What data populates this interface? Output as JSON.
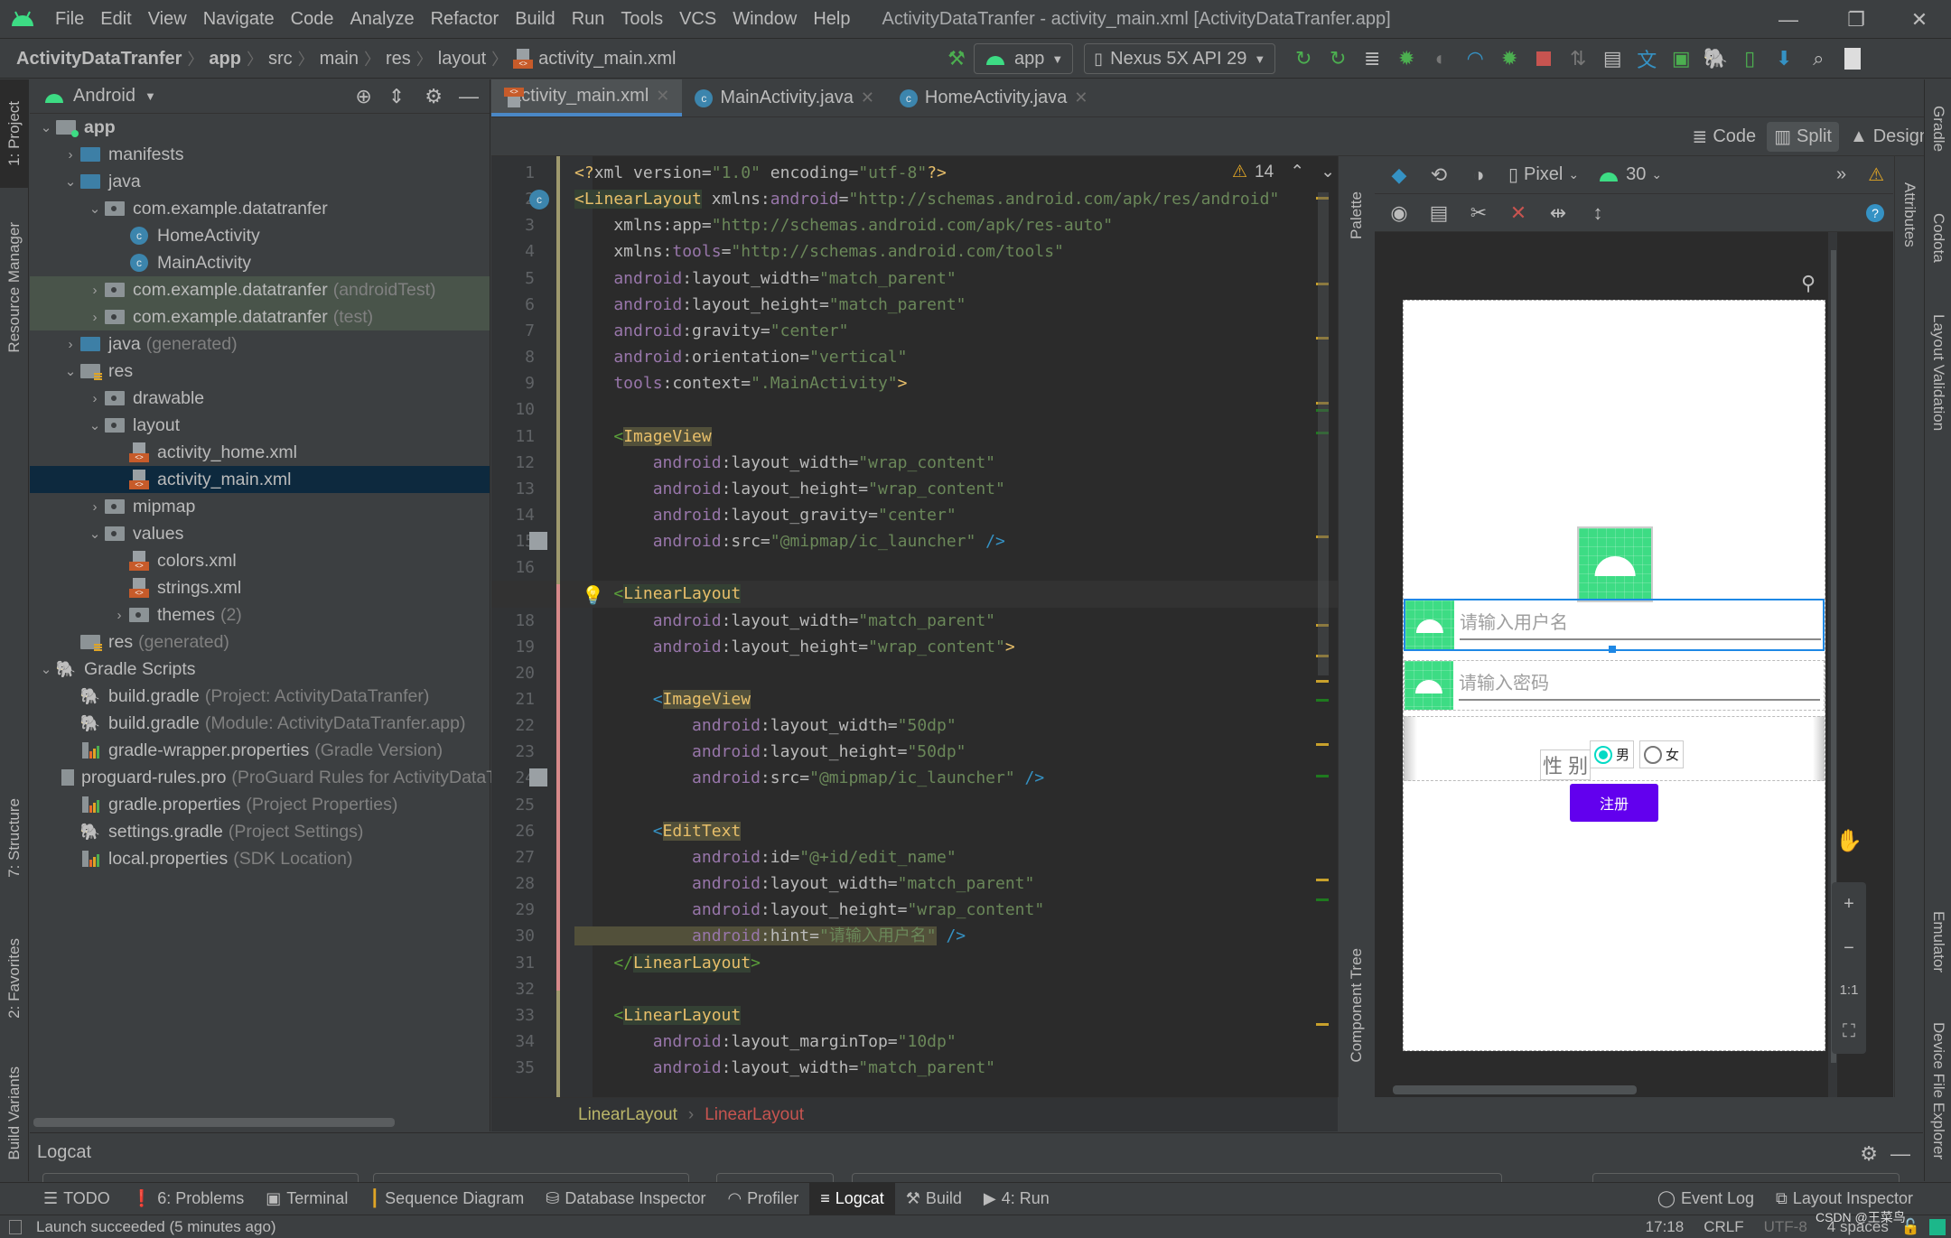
{
  "window": {
    "title": "ActivityDataTranfer - activity_main.xml [ActivityDataTranfer.app]",
    "menu": [
      "File",
      "Edit",
      "View",
      "Navigate",
      "Code",
      "Analyze",
      "Refactor",
      "Build",
      "Run",
      "Tools",
      "VCS",
      "Window",
      "Help"
    ],
    "controls": {
      "minimize": "—",
      "restore": "❐",
      "close": "✕"
    }
  },
  "navbar": {
    "breadcrumb": [
      "ActivityDataTranfer",
      "app",
      "src",
      "main",
      "res",
      "layout",
      "activity_main.xml"
    ],
    "run_config": "app",
    "device": "Nexus 5X API 29"
  },
  "left_stripe": {
    "project": "1: Project",
    "resource_manager": "Resource Manager",
    "structure": "7: Structure",
    "favorites": "2: Favorites",
    "build_variants": "Build Variants"
  },
  "project_panel": {
    "view": "Android",
    "tree": [
      {
        "label": "app",
        "depth": 0,
        "expanded": true,
        "icon": "module-folder-icon",
        "bold": true
      },
      {
        "label": "manifests",
        "depth": 1,
        "expanded": false,
        "icon": "folder-icon",
        "color": "blue"
      },
      {
        "label": "java",
        "depth": 1,
        "expanded": true,
        "icon": "folder-icon",
        "color": "blue"
      },
      {
        "label": "com.example.datatranfer",
        "depth": 2,
        "expanded": true,
        "icon": "package-icon"
      },
      {
        "label": "HomeActivity",
        "depth": 3,
        "icon": "class-icon"
      },
      {
        "label": "MainActivity",
        "depth": 3,
        "icon": "class-icon"
      },
      {
        "label": "com.example.datatranfer",
        "suffix": "(androidTest)",
        "depth": 2,
        "expanded": false,
        "icon": "package-icon",
        "test": true
      },
      {
        "label": "com.example.datatranfer",
        "suffix": "(test)",
        "depth": 2,
        "expanded": false,
        "icon": "package-icon",
        "test": true
      },
      {
        "label": "java",
        "suffix": "(generated)",
        "depth": 1,
        "expanded": false,
        "icon": "generated-folder-icon"
      },
      {
        "label": "res",
        "depth": 1,
        "expanded": true,
        "icon": "res-folder-icon"
      },
      {
        "label": "drawable",
        "depth": 2,
        "expanded": false,
        "icon": "package-icon"
      },
      {
        "label": "layout",
        "depth": 2,
        "expanded": true,
        "icon": "package-icon"
      },
      {
        "label": "activity_home.xml",
        "depth": 3,
        "icon": "xml-file-icon"
      },
      {
        "label": "activity_main.xml",
        "depth": 3,
        "icon": "xml-file-icon",
        "selected": true
      },
      {
        "label": "mipmap",
        "depth": 2,
        "expanded": false,
        "icon": "package-icon"
      },
      {
        "label": "values",
        "depth": 2,
        "expanded": true,
        "icon": "package-icon"
      },
      {
        "label": "colors.xml",
        "depth": 3,
        "icon": "xml-file-icon"
      },
      {
        "label": "strings.xml",
        "depth": 3,
        "icon": "xml-file-icon"
      },
      {
        "label": "themes",
        "suffix": "(2)",
        "depth": 3,
        "expanded": false,
        "icon": "package-icon"
      },
      {
        "label": "res",
        "suffix": "(generated)",
        "depth": 1,
        "icon": "res-folder-icon"
      },
      {
        "label": "Gradle Scripts",
        "depth": 0,
        "expanded": true,
        "icon": "gradle-icon"
      },
      {
        "label": "build.gradle",
        "suffix": "(Project: ActivityDataTranfer)",
        "depth": 1,
        "icon": "gradle-icon"
      },
      {
        "label": "build.gradle",
        "suffix": "(Module: ActivityDataTranfer.app)",
        "depth": 1,
        "icon": "gradle-icon"
      },
      {
        "label": "gradle-wrapper.properties",
        "suffix": "(Gradle Version)",
        "depth": 1,
        "icon": "properties-icon"
      },
      {
        "label": "proguard-rules.pro",
        "suffix": "(ProGuard Rules for ActivityDataTranfer.app)",
        "depth": 1,
        "icon": "text-file-icon"
      },
      {
        "label": "gradle.properties",
        "suffix": "(Project Properties)",
        "depth": 1,
        "icon": "properties-icon"
      },
      {
        "label": "settings.gradle",
        "suffix": "(Project Settings)",
        "depth": 1,
        "icon": "gradle-icon"
      },
      {
        "label": "local.properties",
        "suffix": "(SDK Location)",
        "depth": 1,
        "icon": "properties-icon"
      }
    ]
  },
  "editor_tabs": [
    {
      "label": "activity_main.xml",
      "icon": "xml-file-icon",
      "active": true
    },
    {
      "label": "MainActivity.java",
      "icon": "class-icon"
    },
    {
      "label": "HomeActivity.java",
      "icon": "class-icon"
    }
  ],
  "view_modes": {
    "code": "Code",
    "split": "Split",
    "design": "Design",
    "active": "split"
  },
  "warnings": {
    "count": "14"
  },
  "code_lines": [
    [
      [
        "pi",
        "<?"
      ],
      [
        "attr",
        "xml version"
      ],
      [
        "pl",
        "="
      ],
      [
        "str",
        "\"1.0\""
      ],
      [
        "attr",
        " encoding"
      ],
      [
        "pl",
        "="
      ],
      [
        "str",
        "\"utf-8\""
      ],
      [
        "pi",
        "?>"
      ]
    ],
    [
      [
        "tagh",
        "<LinearLayout"
      ],
      [
        "attr",
        " xmlns:"
      ],
      [
        "ns",
        "android"
      ],
      [
        "pl",
        "="
      ],
      [
        "str",
        "\"http://schemas.android.com/apk/res/android\""
      ]
    ],
    [
      [
        "attr",
        "    xmlns:app"
      ],
      [
        "pl",
        "="
      ],
      [
        "str",
        "\"http://schemas.android.com/apk/res-auto\""
      ]
    ],
    [
      [
        "attr",
        "    xmlns:"
      ],
      [
        "ns",
        "tools"
      ],
      [
        "pl",
        "="
      ],
      [
        "str",
        "\"http://schemas.android.com/tools\""
      ]
    ],
    [
      [
        "ns",
        "    android"
      ],
      [
        "attr",
        ":layout_width"
      ],
      [
        "pl",
        "="
      ],
      [
        "str",
        "\"match_parent\""
      ]
    ],
    [
      [
        "ns",
        "    android"
      ],
      [
        "attr",
        ":layout_height"
      ],
      [
        "pl",
        "="
      ],
      [
        "str",
        "\"match_parent\""
      ]
    ],
    [
      [
        "ns",
        "    android"
      ],
      [
        "attr",
        ":gravity"
      ],
      [
        "pl",
        "="
      ],
      [
        "str",
        "\"center\""
      ]
    ],
    [
      [
        "ns",
        "    android"
      ],
      [
        "attr",
        ":orientation"
      ],
      [
        "pl",
        "="
      ],
      [
        "str",
        "\"vertical\""
      ]
    ],
    [
      [
        "ns",
        "    tools"
      ],
      [
        "attr",
        ":context"
      ],
      [
        "pl",
        "="
      ],
      [
        "str",
        "\".MainActivity\""
      ],
      [
        "br",
        ">"
      ]
    ],
    [],
    [
      [
        "lt",
        "    <"
      ],
      [
        "tagy",
        "ImageView"
      ]
    ],
    [
      [
        "ns",
        "        android"
      ],
      [
        "attr",
        ":layout_width"
      ],
      [
        "pl",
        "="
      ],
      [
        "str",
        "\"wrap_content\""
      ]
    ],
    [
      [
        "ns",
        "        android"
      ],
      [
        "attr",
        ":layout_height"
      ],
      [
        "pl",
        "="
      ],
      [
        "str",
        "\"wrap_content\""
      ]
    ],
    [
      [
        "ns",
        "        android"
      ],
      [
        "attr",
        ":layout_gravity"
      ],
      [
        "pl",
        "="
      ],
      [
        "str",
        "\"center\""
      ]
    ],
    [
      [
        "ns",
        "        android"
      ],
      [
        "attr",
        ":src"
      ],
      [
        "pl",
        "="
      ],
      [
        "str",
        "\"@mipmap/ic_launcher\""
      ],
      [
        "blt",
        " />"
      ]
    ],
    [],
    [
      [
        "lt",
        "    <"
      ],
      [
        "tagg",
        "LinearLayout"
      ]
    ],
    [
      [
        "ns",
        "        android"
      ],
      [
        "attr",
        ":layout_width"
      ],
      [
        "pl",
        "="
      ],
      [
        "str",
        "\"match_parent\""
      ]
    ],
    [
      [
        "ns",
        "        android"
      ],
      [
        "attr",
        ":layout_height"
      ],
      [
        "pl",
        "="
      ],
      [
        "str",
        "\"wrap_content\""
      ],
      [
        "br",
        ">"
      ]
    ],
    [],
    [
      [
        "blt",
        "        <"
      ],
      [
        "tagy",
        "ImageView"
      ]
    ],
    [
      [
        "ns",
        "            android"
      ],
      [
        "attr",
        ":layout_width"
      ],
      [
        "pl",
        "="
      ],
      [
        "str",
        "\"50dp\""
      ]
    ],
    [
      [
        "ns",
        "            android"
      ],
      [
        "attr",
        ":layout_height"
      ],
      [
        "pl",
        "="
      ],
      [
        "str",
        "\"50dp\""
      ]
    ],
    [
      [
        "ns",
        "            android"
      ],
      [
        "attr",
        ":src"
      ],
      [
        "pl",
        "="
      ],
      [
        "str",
        "\"@mipmap/ic_launcher\""
      ],
      [
        "blt",
        " />"
      ]
    ],
    [],
    [
      [
        "blt",
        "        <"
      ],
      [
        "tagy",
        "EditText"
      ]
    ],
    [
      [
        "ns",
        "            android"
      ],
      [
        "attr",
        ":id"
      ],
      [
        "pl",
        "="
      ],
      [
        "str",
        "\"@+id/edit_name\""
      ]
    ],
    [
      [
        "ns",
        "            android"
      ],
      [
        "attr",
        ":layout_width"
      ],
      [
        "pl",
        "="
      ],
      [
        "str",
        "\"match_parent\""
      ]
    ],
    [
      [
        "ns",
        "            android"
      ],
      [
        "attr",
        ":layout_height"
      ],
      [
        "pl",
        "="
      ],
      [
        "str",
        "\"wrap_content\""
      ]
    ],
    [
      [
        "nsh",
        "            android"
      ],
      [
        "attrh",
        ":hint"
      ],
      [
        "plh",
        "="
      ],
      [
        "strh",
        "\"请输入用户名\""
      ],
      [
        "blt",
        " />"
      ]
    ],
    [
      [
        "lt",
        "    </"
      ],
      [
        "tagg",
        "LinearLayout"
      ],
      [
        "lt",
        ">"
      ]
    ],
    [],
    [
      [
        "lt",
        "    <"
      ],
      [
        "tagg",
        "LinearLayout"
      ]
    ],
    [
      [
        "ns",
        "        android"
      ],
      [
        "attr",
        ":layout_marginTop"
      ],
      [
        "pl",
        "="
      ],
      [
        "str",
        "\"10dp\""
      ]
    ],
    [
      [
        "ns",
        "        android"
      ],
      [
        "attr",
        ":layout_width"
      ],
      [
        "pl",
        "="
      ],
      [
        "str",
        "\"match_parent\""
      ]
    ]
  ],
  "code_breadcrumb": [
    "LinearLayout",
    "LinearLayout"
  ],
  "design_toolbar": {
    "device": "Pixel",
    "api": "30"
  },
  "preview": {
    "username_hint": "请输入用户名",
    "password_hint": "请输入密码",
    "gender_label": "性 别",
    "gender_options": [
      {
        "label": "男",
        "checked": true
      },
      {
        "label": "女",
        "checked": false
      }
    ],
    "register_button": "注册",
    "accent_color": "#6200ee",
    "radio_color": "#03dac5",
    "zoom_fit": "1:1"
  },
  "design_side": {
    "palette": "Palette",
    "component_tree": "Component Tree",
    "attributes": "Attributes"
  },
  "right_stripe": {
    "gradle": "Gradle",
    "codota": "Codota",
    "layout_validation": "Layout Validation",
    "emulator": "Emulator",
    "device_file_explorer": "Device File Explorer"
  },
  "logcat": {
    "title": "Logcat"
  },
  "bottom_tabs": [
    {
      "label": "TODO",
      "icon": "list-icon"
    },
    {
      "label": "6: Problems",
      "icon": "problems-icon"
    },
    {
      "label": "Terminal",
      "icon": "terminal-icon"
    },
    {
      "label": "Sequence Diagram",
      "icon": "sequence-icon"
    },
    {
      "label": "Database Inspector",
      "icon": "database-icon"
    },
    {
      "label": "Profiler",
      "icon": "profiler-icon"
    },
    {
      "label": "Logcat",
      "icon": "logcat-icon",
      "active": true
    },
    {
      "label": "Build",
      "icon": "hammer-icon"
    },
    {
      "label": "4: Run",
      "icon": "run-icon"
    }
  ],
  "bottom_right_tabs": [
    {
      "label": "Event Log",
      "icon": "event-log-icon"
    },
    {
      "label": "Layout Inspector",
      "icon": "layout-inspector-icon"
    }
  ],
  "status": {
    "message": "Launch succeeded (5 minutes ago)",
    "position": "17:18",
    "line_sep": "CRLF",
    "encoding": "UTF-8",
    "indent": "4 spaces",
    "watermark": "CSDN @王菜鸟"
  }
}
